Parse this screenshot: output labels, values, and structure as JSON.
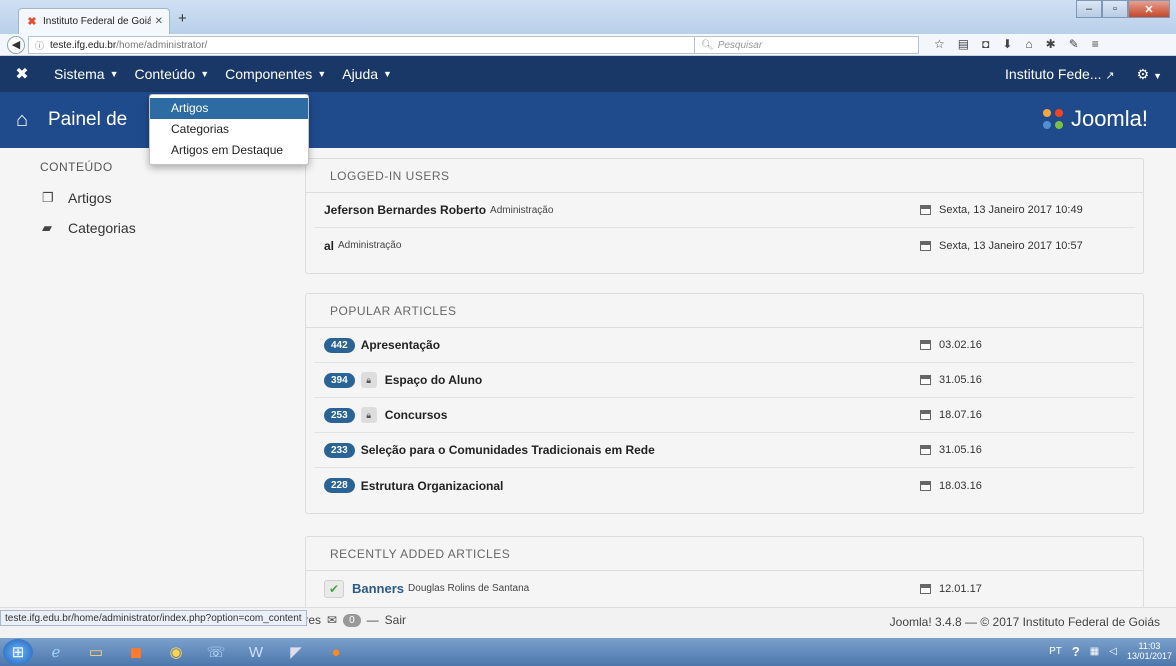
{
  "browser": {
    "tab_title": "Instituto Federal de Goiás -...",
    "url_host": "teste.ifg.edu.br",
    "url_path": "/home/administrator/",
    "search_placeholder": "Pesquisar"
  },
  "topnav": {
    "items": [
      {
        "label": "Sistema"
      },
      {
        "label": "Conteúdo"
      },
      {
        "label": "Componentes"
      },
      {
        "label": "Ajuda"
      }
    ],
    "site_label": "Instituto Fede..."
  },
  "subhead": {
    "title": "Painel de",
    "brand": "Joomla!"
  },
  "dropdown": {
    "items": [
      "Artigos",
      "Categorias",
      "Artigos em Destaque"
    ],
    "active_index": 0
  },
  "sidebar": {
    "heading": "CONTEÚDO",
    "items": [
      {
        "label": "Artigos",
        "icon": "copy-icon"
      },
      {
        "label": "Categorias",
        "icon": "folder-icon"
      }
    ]
  },
  "logged_in": {
    "title": "LOGGED-IN USERS",
    "rows": [
      {
        "name": "Jeferson Bernardes Roberto",
        "role": "Administração",
        "date": "Sexta, 13 Janeiro 2017 10:49"
      },
      {
        "name": "al",
        "role": "Administração",
        "date": "Sexta, 13 Janeiro 2017 10:57"
      }
    ]
  },
  "popular": {
    "title": "POPULAR ARTICLES",
    "rows": [
      {
        "hits": "442",
        "locked": false,
        "title": "Apresentação",
        "date": "03.02.16"
      },
      {
        "hits": "394",
        "locked": true,
        "title": "Espaço do Aluno",
        "date": "31.05.16"
      },
      {
        "hits": "253",
        "locked": true,
        "title": "Concursos",
        "date": "18.07.16"
      },
      {
        "hits": "233",
        "locked": false,
        "title": "Seleção para o Comunidades Tradicionais em Rede",
        "date": "31.05.16"
      },
      {
        "hits": "228",
        "locked": false,
        "title": "Estrutura Organizacional",
        "date": "18.03.16"
      }
    ]
  },
  "recent": {
    "title": "RECENTLY ADDED ARTICLES",
    "rows": [
      {
        "title": "Banners",
        "author": "Douglas Rolins de Santana",
        "date": "12.01.17"
      }
    ]
  },
  "status": {
    "hover_url": "teste.ifg.edu.br/home/administrator/index.php?option=com_content",
    "left_text": "dores",
    "count": "0",
    "logout": "Sair",
    "footer": "Joomla! 3.4.8 — © 2017 Instituto Federal de Goiás"
  },
  "taskbar": {
    "lang": "PT",
    "time": "11:03",
    "date": "13/01/2017"
  }
}
